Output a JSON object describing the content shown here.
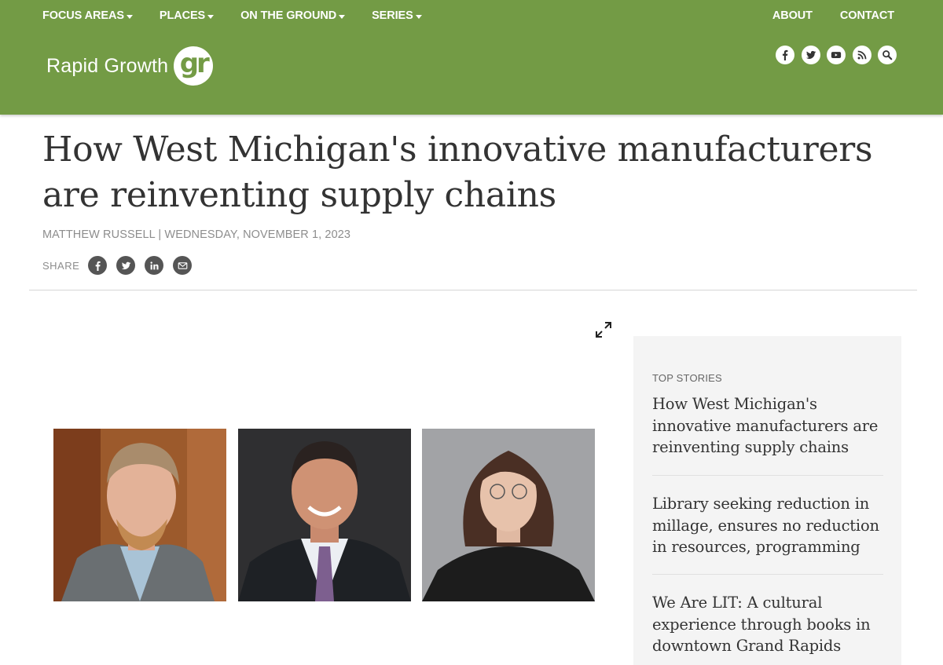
{
  "header": {
    "nav_left": [
      {
        "label": "FOCUS AREAS"
      },
      {
        "label": "PLACES"
      },
      {
        "label": "ON THE GROUND"
      },
      {
        "label": "SERIES"
      }
    ],
    "nav_right": [
      {
        "label": "ABOUT"
      },
      {
        "label": "CONTACT"
      }
    ],
    "logo_text": "Rapid Growth",
    "logo_mark": "gr",
    "social_icons": [
      "facebook-icon",
      "twitter-icon",
      "youtube-icon",
      "rss-icon",
      "search-icon"
    ],
    "brand_color": "#739b45"
  },
  "article": {
    "title": "How West Michigan's innovative manufacturers are reinventing supply chains",
    "byline": "MATTHEW RUSSELL | WEDNESDAY, NOVEMBER 1, 2023",
    "share_label": "SHARE",
    "share_icons": [
      "facebook-icon",
      "twitter-icon",
      "linkedin-icon",
      "email-icon"
    ]
  },
  "sidebar": {
    "label": "TOP STORIES",
    "stories": [
      {
        "title": "How West Michigan's innovative manufacturers are reinventing supply chains"
      },
      {
        "title": "Library seeking reduction in millage, ensures no reduction in resources, programming"
      },
      {
        "title": "We Are LIT: A cultural experience through books in downtown Grand Rapids"
      }
    ]
  }
}
